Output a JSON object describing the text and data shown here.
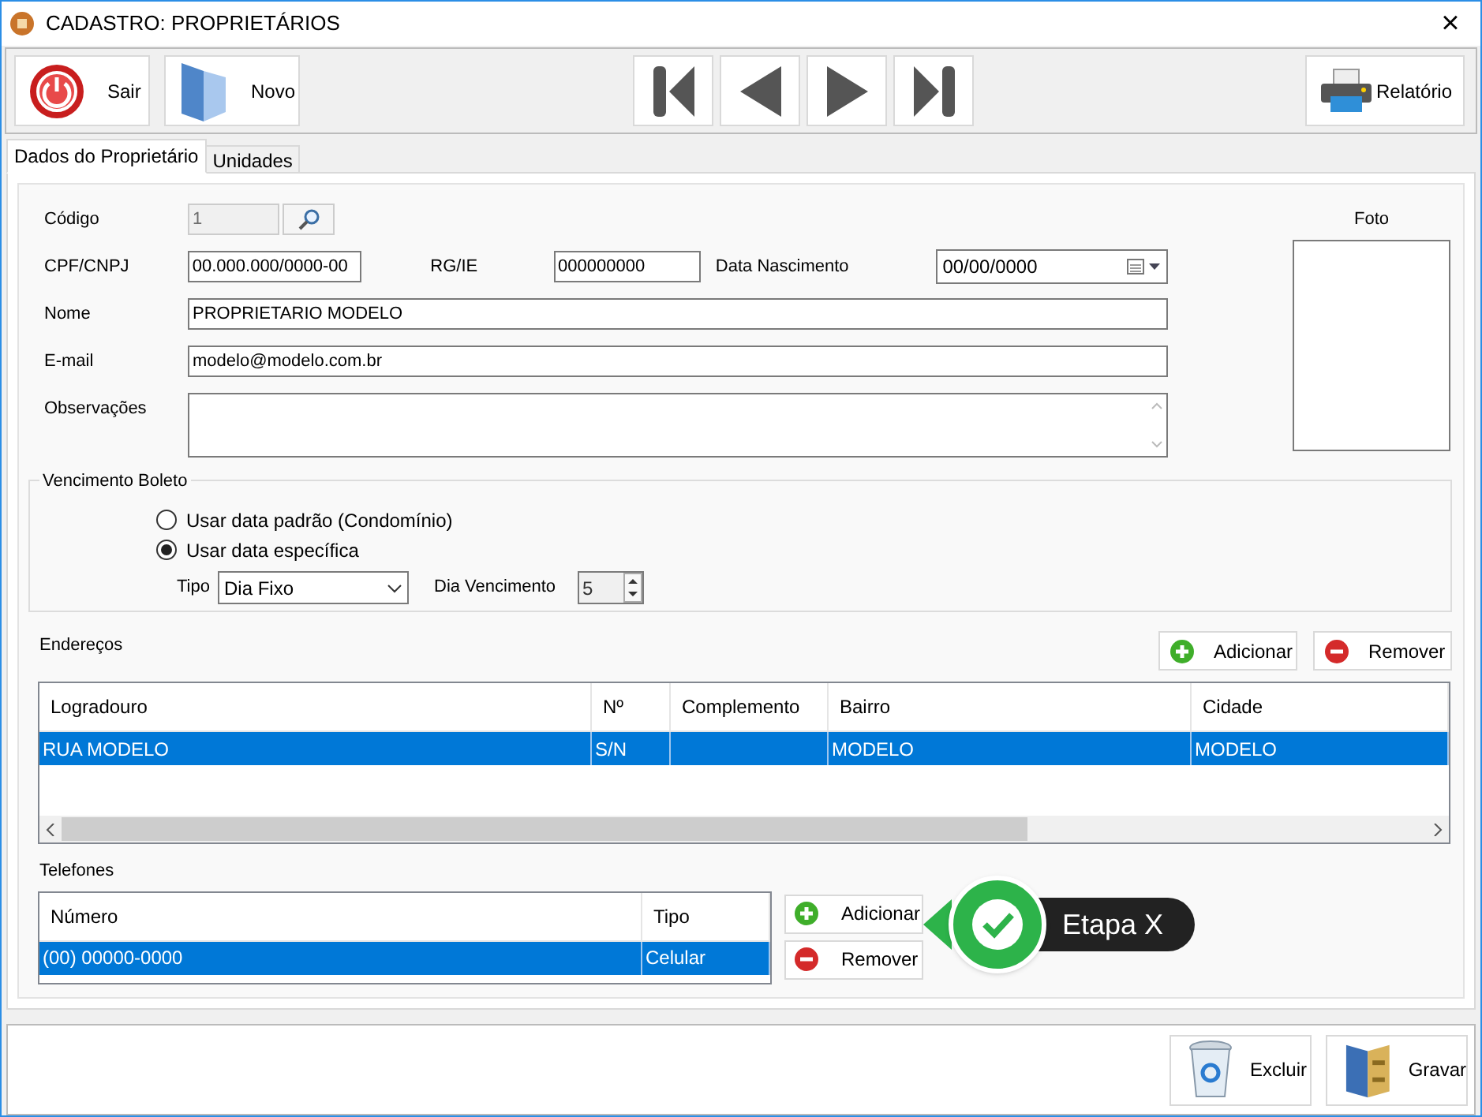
{
  "window": {
    "title": "CADASTRO: PROPRIETÁRIOS",
    "close": "×"
  },
  "toolbar": {
    "left": [
      {
        "kind": "exit",
        "label": "Sair"
      },
      {
        "kind": "new",
        "label": "Novo"
      }
    ],
    "nav": [
      {
        "kind": "first"
      },
      {
        "kind": "prev"
      },
      {
        "kind": "next"
      },
      {
        "kind": "last"
      }
    ],
    "right": [
      {
        "kind": "report",
        "label": "Relatório"
      }
    ]
  },
  "tabs": [
    {
      "label": "Dados do Proprietário",
      "selected": true
    },
    {
      "label": "Unidades",
      "selected": false
    }
  ],
  "form": {
    "codigo": {
      "label": "Código",
      "value": "1",
      "disabled": true
    },
    "cpf": {
      "label": "CPF/CNPJ",
      "value": "00.000.000/0000-00"
    },
    "rg": {
      "label": "RG/IE",
      "value": "000000000"
    },
    "nascimento": {
      "label": "Data Nascimento",
      "value": "00/00/0000"
    },
    "nome": {
      "label": "Nome",
      "value": "PROPRIETARIO MODELO"
    },
    "email": {
      "label": "E-mail",
      "value": "modelo@modelo.com.br"
    },
    "observacoes": {
      "label": "Observações"
    },
    "foto": {
      "label": "Foto"
    }
  },
  "vencimento": {
    "title": "Vencimento Boleto",
    "options": [
      {
        "label": "Usar data padrão (Condomínio)",
        "selected": false
      },
      {
        "label": "Usar data específica",
        "selected": true
      }
    ],
    "tipo": {
      "label": "Tipo",
      "value": "Dia Fixo"
    },
    "dia": {
      "label": "Dia Vencimento",
      "value": "5"
    }
  },
  "enderecos": {
    "title": "Endereços",
    "buttons": [
      {
        "kind": "add",
        "label": "Adicionar"
      },
      {
        "kind": "remove",
        "label": "Remover"
      }
    ],
    "columns": [
      "Logradouro",
      "Nº",
      "Complemento",
      "Bairro",
      "Cidade"
    ],
    "rows": [
      {
        "cells": [
          "RUA MODELO",
          "S/N",
          "",
          "MODELO",
          "MODELO"
        ],
        "selected": true
      }
    ]
  },
  "telefones": {
    "title": "Telefones",
    "buttons": [
      {
        "kind": "add",
        "label": "Adicionar"
      },
      {
        "kind": "remove",
        "label": "Remover"
      }
    ],
    "columns": [
      "Número",
      "Tipo"
    ],
    "rows": [
      {
        "cells": [
          "(00) 00000-0000",
          "Celular"
        ],
        "selected": true
      }
    ]
  },
  "callout": {
    "label": "Etapa X"
  },
  "footer": [
    {
      "kind": "delete",
      "label": "Excluir"
    },
    {
      "kind": "save",
      "label": "Gravar"
    }
  ]
}
